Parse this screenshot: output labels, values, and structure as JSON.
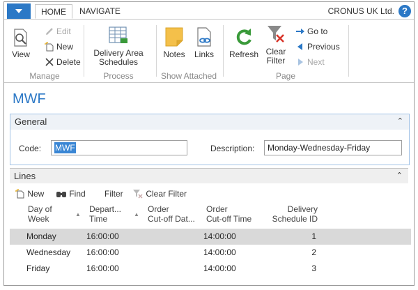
{
  "tabs": {
    "home": "HOME",
    "navigate": "NAVIGATE"
  },
  "company": "CRONUS UK Ltd.",
  "help": "?",
  "ribbon": {
    "manage": {
      "view": "View",
      "edit": "Edit",
      "new": "New",
      "delete": "Delete",
      "label": "Manage"
    },
    "process": {
      "delivery_l1": "Delivery Area",
      "delivery_l2": "Schedules",
      "label": "Process"
    },
    "show_attached": {
      "notes": "Notes",
      "links": "Links",
      "label": "Show Attached"
    },
    "page": {
      "refresh": "Refresh",
      "clear_l1": "Clear",
      "clear_l2": "Filter",
      "goto": "Go to",
      "previous": "Previous",
      "next": "Next",
      "label": "Page"
    }
  },
  "page_title": "MWF",
  "general": {
    "header": "General",
    "code_label": "Code:",
    "code_value": "MWF",
    "description_label": "Description:",
    "description_value": "Monday-Wednesday-Friday"
  },
  "lines": {
    "header": "Lines",
    "toolbar": {
      "new": "New",
      "find": "Find",
      "filter": "Filter",
      "clear_filter": "Clear Filter"
    },
    "columns": [
      {
        "l1": "Day of",
        "l2": "Week"
      },
      {
        "l1": "Depart...",
        "l2": "Time"
      },
      {
        "l1": "Order",
        "l2": "Cut-off Dat..."
      },
      {
        "l1": "Order",
        "l2": "Cut-off Time"
      },
      {
        "l1": "Delivery",
        "l2": "Schedule ID"
      }
    ],
    "rows": [
      {
        "day": "Monday",
        "depart": "16:00:00",
        "cutoff_date": "",
        "cutoff_time": "14:00:00",
        "schedule_id": "1"
      },
      {
        "day": "Wednesday",
        "depart": "16:00:00",
        "cutoff_date": "",
        "cutoff_time": "14:00:00",
        "schedule_id": "2"
      },
      {
        "day": "Friday",
        "depart": "16:00:00",
        "cutoff_date": "",
        "cutoff_time": "14:00:00",
        "schedule_id": "3"
      }
    ]
  },
  "icons": [
    "app-menu-icon",
    "help-icon",
    "view-icon",
    "edit-icon",
    "new-icon",
    "delete-icon",
    "delivery-schedules-icon",
    "notes-icon",
    "links-icon",
    "refresh-icon",
    "clear-filter-icon",
    "goto-icon",
    "previous-icon",
    "next-icon",
    "find-icon",
    "filter-icon",
    "collapse-chevron-icon",
    "sort-arrow-icon"
  ],
  "colors": {
    "accent": "#2b78c6",
    "selected_row": "#d9d9d9",
    "fasttab_border": "#a3c3e6"
  }
}
